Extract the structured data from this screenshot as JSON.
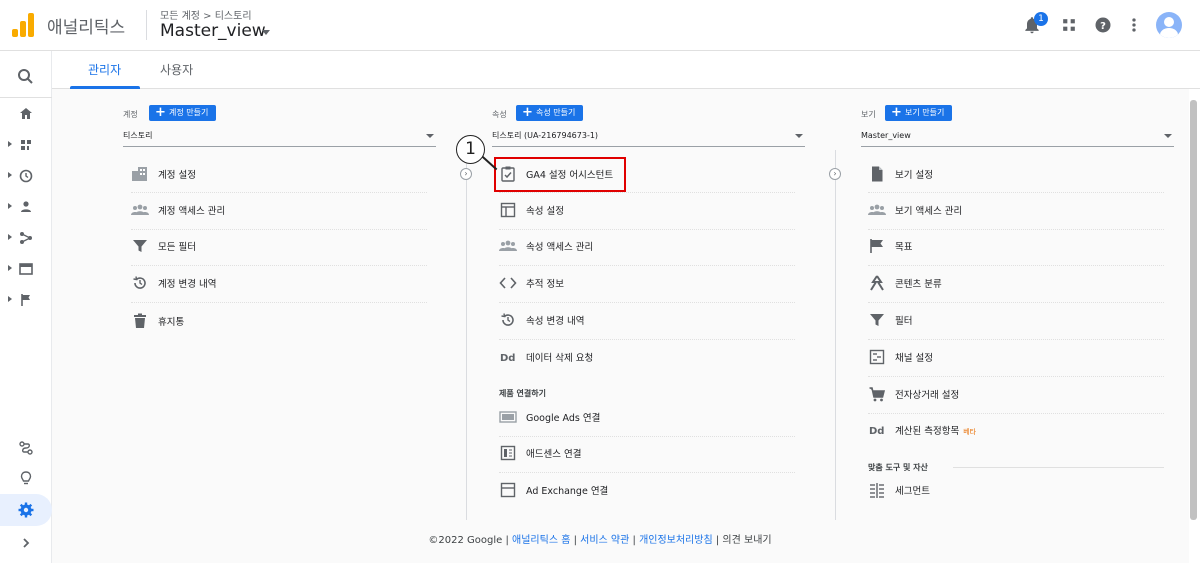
{
  "header": {
    "app_name": "애널리틱스",
    "breadcrumb": "모든 계정 > 티스토리",
    "view_name": "Master_view",
    "notification_count": "1"
  },
  "tabs": [
    {
      "label": "관리자",
      "active": true
    },
    {
      "label": "사용자",
      "active": false
    }
  ],
  "account_column": {
    "title": "계정",
    "create_button": "계정 만들기",
    "selected": "티스토리",
    "items": [
      {
        "icon": "building-icon",
        "label": "계정 설정"
      },
      {
        "icon": "people-icon",
        "label": "계정 액세스 관리"
      },
      {
        "icon": "filter-icon",
        "label": "모든 필터"
      },
      {
        "icon": "history-icon",
        "label": "계정 변경 내역"
      },
      {
        "icon": "trash-icon",
        "label": "휴지통"
      }
    ]
  },
  "property_column": {
    "title": "속성",
    "create_button": "속성 만들기",
    "selected": "티스토리 (UA-216794673-1)",
    "items": [
      {
        "icon": "checklist-icon",
        "label": "GA4 설정 어시스턴트"
      },
      {
        "icon": "layout-icon",
        "label": "속성 설정"
      },
      {
        "icon": "people-icon",
        "label": "속성 액세스 관리"
      },
      {
        "icon": "code-icon",
        "label": "추적 정보"
      },
      {
        "icon": "history-icon",
        "label": "속성 변경 내역"
      },
      {
        "icon": "dd-icon",
        "label": "데이터 삭제 요청"
      }
    ],
    "product_links_title": "제품 연결하기",
    "product_links": [
      {
        "icon": "google-ads-icon",
        "label": "Google Ads 연결"
      },
      {
        "icon": "adsense-icon",
        "label": "애드센스 연결"
      },
      {
        "icon": "ad-exchange-icon",
        "label": "Ad Exchange 연결"
      }
    ]
  },
  "view_column": {
    "title": "보기",
    "create_button": "보기 만들기",
    "selected": "Master_view",
    "items": [
      {
        "icon": "document-icon",
        "label": "보기 설정"
      },
      {
        "icon": "people-icon",
        "label": "보기 액세스 관리"
      },
      {
        "icon": "flag-icon",
        "label": "목표"
      },
      {
        "icon": "grouping-icon",
        "label": "콘텐츠 분류"
      },
      {
        "icon": "filter-icon",
        "label": "필터"
      },
      {
        "icon": "channel-icon",
        "label": "채널 설정"
      },
      {
        "icon": "cart-icon",
        "label": "전자상거래 설정"
      },
      {
        "icon": "dd-icon",
        "label": "계산된 측정항목",
        "badge": "베타"
      }
    ],
    "tools_title": "맞춤 도구 및 자산",
    "tools": [
      {
        "icon": "segment-icon",
        "label": "세그먼트"
      }
    ]
  },
  "annotation": {
    "number": "1"
  },
  "footer": {
    "copyright": "©2022 Google",
    "links": [
      "애널리틱스 홈",
      "서비스 약관",
      "개인정보처리방침"
    ],
    "separator": " | ",
    "feedback_prefix": "의견",
    "feedback_suffix": "보내기"
  },
  "colors": {
    "accent": "#1a73e8",
    "logo": "#f9ab00",
    "highlight": "#e00000"
  }
}
